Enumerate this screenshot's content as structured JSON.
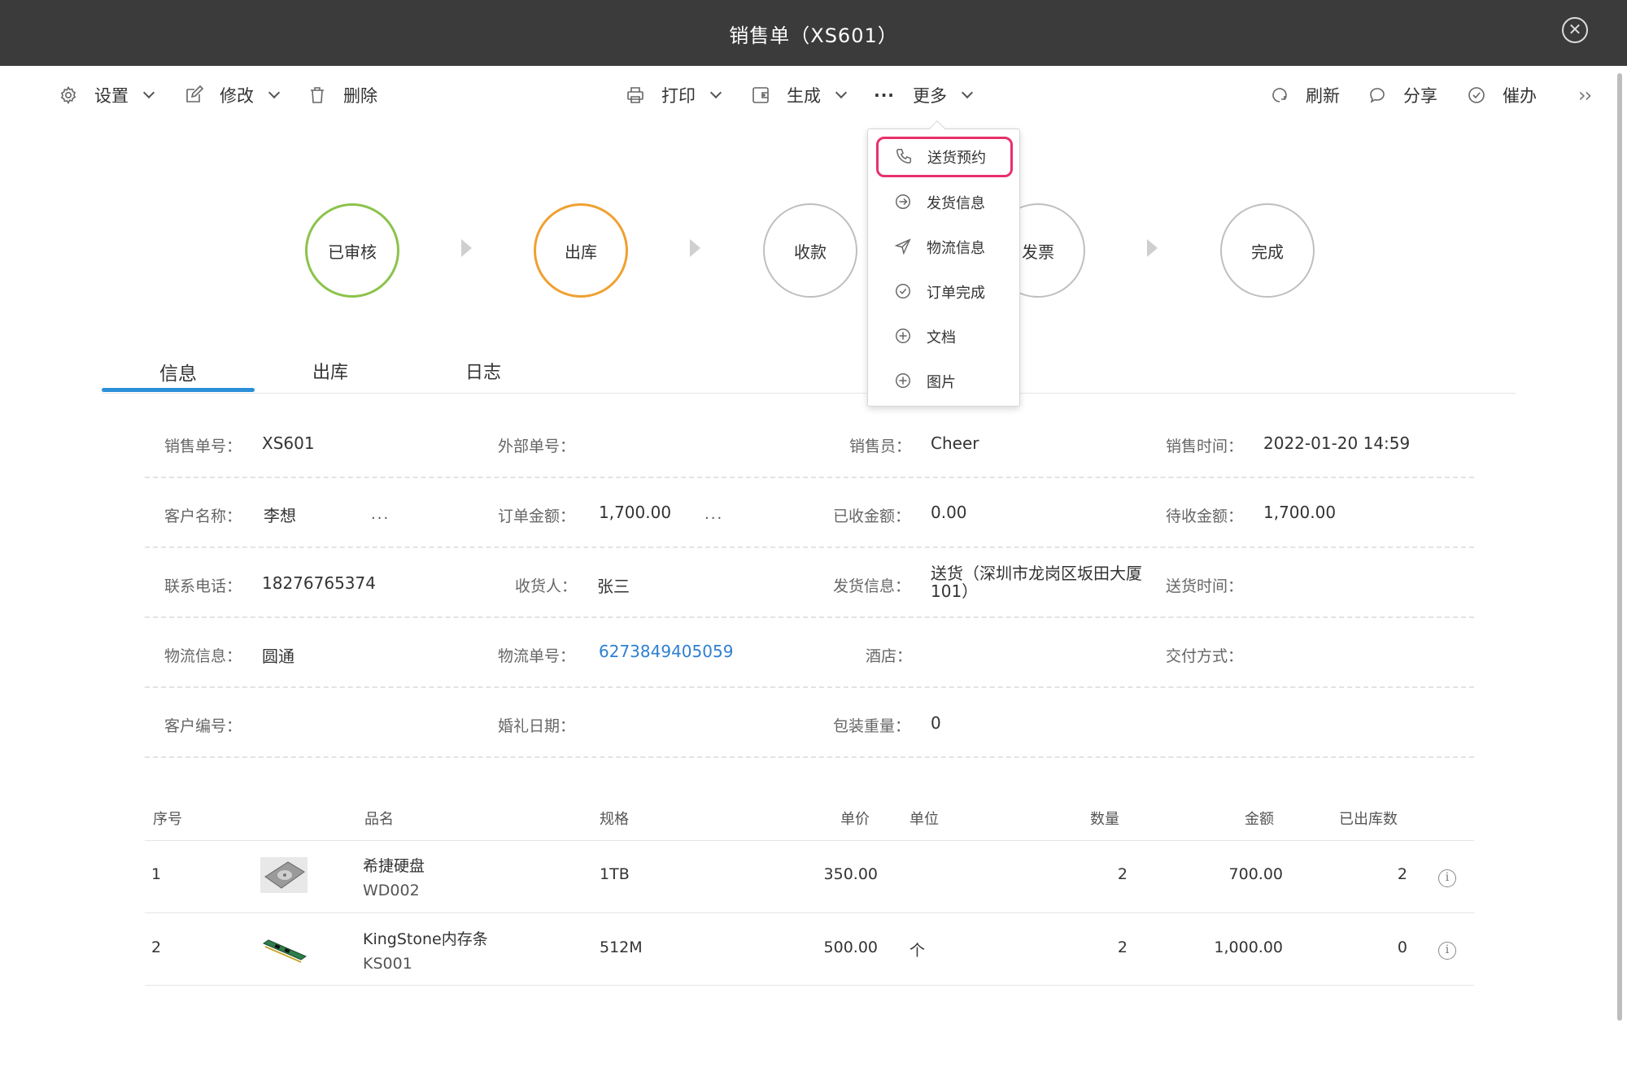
{
  "window": {
    "title": "销售单（XS601）",
    "close_icon": "close-circle-icon"
  },
  "toolbar": {
    "settings": "设置",
    "edit": "修改",
    "delete": "删除",
    "print": "打印",
    "generate": "生成",
    "more": "更多",
    "refresh": "刷新",
    "share": "分享",
    "urge": "催办",
    "expand": "››"
  },
  "more_menu": {
    "items": [
      {
        "label": "送货预约",
        "icon": "phone-icon",
        "highlighted": true
      },
      {
        "label": "发货信息",
        "icon": "arrow-circle-icon"
      },
      {
        "label": "物流信息",
        "icon": "send-icon"
      },
      {
        "label": "订单完成",
        "icon": "check-circle-icon"
      },
      {
        "label": "文档",
        "icon": "plus-circle-icon"
      },
      {
        "label": "图片",
        "icon": "plus-circle-icon"
      }
    ]
  },
  "steps": [
    {
      "label": "已审核",
      "status": "done",
      "color": "#8bc34a"
    },
    {
      "label": "出库",
      "status": "current",
      "color": "#f0a030"
    },
    {
      "label": "收款",
      "status": "pending"
    },
    {
      "label": "发票",
      "status": "pending"
    },
    {
      "label": "完成",
      "status": "pending"
    }
  ],
  "tabs": [
    "信息",
    "出库",
    "日志"
  ],
  "info": {
    "sale_no_label": "销售单号：",
    "sale_no": "XS601",
    "ext_no_label": "外部单号：",
    "ext_no": "",
    "salesperson_label": "销售员：",
    "salesperson": "Cheer",
    "sale_time_label": "销售时间：",
    "sale_time": "2022-01-20 14:59",
    "customer_label": "客户名称：",
    "customer": "李想",
    "order_amount_label": "订单金额：",
    "order_amount": "1,700.00",
    "received_label": "已收金额：",
    "received": "0.00",
    "pending_label": "待收金额：",
    "pending": "1,700.00",
    "phone_label": "联系电话：",
    "phone": "18276765374",
    "receiver_label": "收货人：",
    "receiver": "张三",
    "shipping_label": "发货信息：",
    "shipping": "送货（深圳市龙岗区坂田大厦101）",
    "delivery_time_label": "送货时间：",
    "delivery_time": "",
    "logistics_label": "物流信息：",
    "logistics": "圆通",
    "tracking_label": "物流单号：",
    "tracking": "6273849405059",
    "hotel_label": "酒店：",
    "hotel": "",
    "payment_label": "交付方式：",
    "payment": "",
    "customer_no_label": "客户编号：",
    "customer_no": "",
    "wedding_label": "婚礼日期：",
    "wedding": "",
    "weight_label": "包装重量：",
    "weight": "0",
    "more_dots": "..."
  },
  "table": {
    "headers": [
      "序号",
      "品名",
      "规格",
      "单价",
      "单位",
      "数量",
      "金额",
      "已出库数"
    ],
    "rows": [
      {
        "no": "1",
        "name": "希捷硬盘",
        "code": "WD002",
        "spec": "1TB",
        "price": "350.00",
        "unit": "",
        "qty": "2",
        "amount": "700.00",
        "shipped": "2"
      },
      {
        "no": "2",
        "name": "KingStone内存条",
        "code": "KS001",
        "spec": "512M",
        "price": "500.00",
        "unit": "个",
        "qty": "2",
        "amount": "1,000.00",
        "shipped": "0"
      }
    ],
    "info_icon": "i"
  }
}
